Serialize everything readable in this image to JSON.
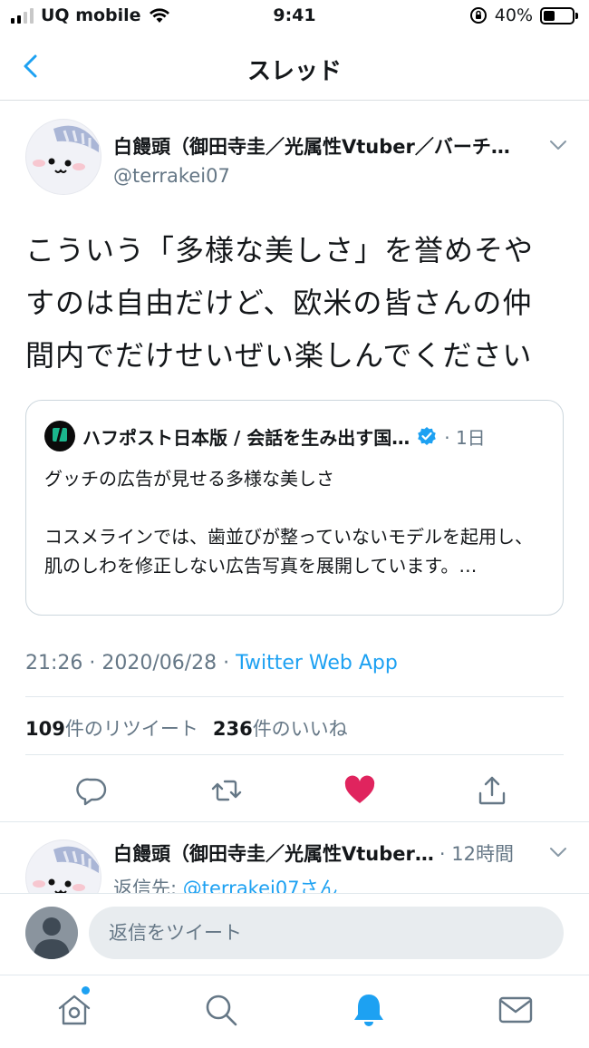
{
  "status_bar": {
    "carrier": "UQ mobile",
    "time": "9:41",
    "battery": "40%",
    "battery_level": 0.4
  },
  "header": {
    "title": "スレッド"
  },
  "tweet": {
    "author_name": "白饅頭（御田寺圭／光属性Vtuber／バーチ…",
    "author_handle": "@terrakei07",
    "text": "こういう「多様な美しさ」を誉めそや\nすのは自由だけど、欧米の皆さんの仲\n間内でだけせいぜい楽しんでください",
    "quoted": {
      "author_name": "ハフポスト日本版 / 会話を生み出す国…",
      "time": "· 1日",
      "text": "グッチの広告が見せる多様な美しさ\n\nコスメラインでは、歯並びが整っていないモデルを起用し、肌のしわを修正しない広告写真を展開しています。…"
    },
    "timestamp": "21:26 · 2020/06/28 · ",
    "source": "Twitter Web App",
    "retweet_count": "109",
    "retweet_label": "件のリツイート",
    "like_count": "236",
    "like_label": "件のいいね",
    "liked": true
  },
  "reply": {
    "author_name": "白饅頭（御田寺圭／光属性Vtuber…",
    "time": "· 12時間",
    "reply_to_prefix": "返信先: ",
    "reply_to_handle": "@terrakei07さん"
  },
  "composer": {
    "placeholder": "返信をツイート"
  },
  "tab_bar": {
    "items": [
      "home-icon",
      "search-icon",
      "notifications-icon",
      "messages-icon"
    ],
    "active": "notifications-icon"
  },
  "colors": {
    "accent": "#1da1f2",
    "like": "#e0245e",
    "muted": "#657786"
  }
}
